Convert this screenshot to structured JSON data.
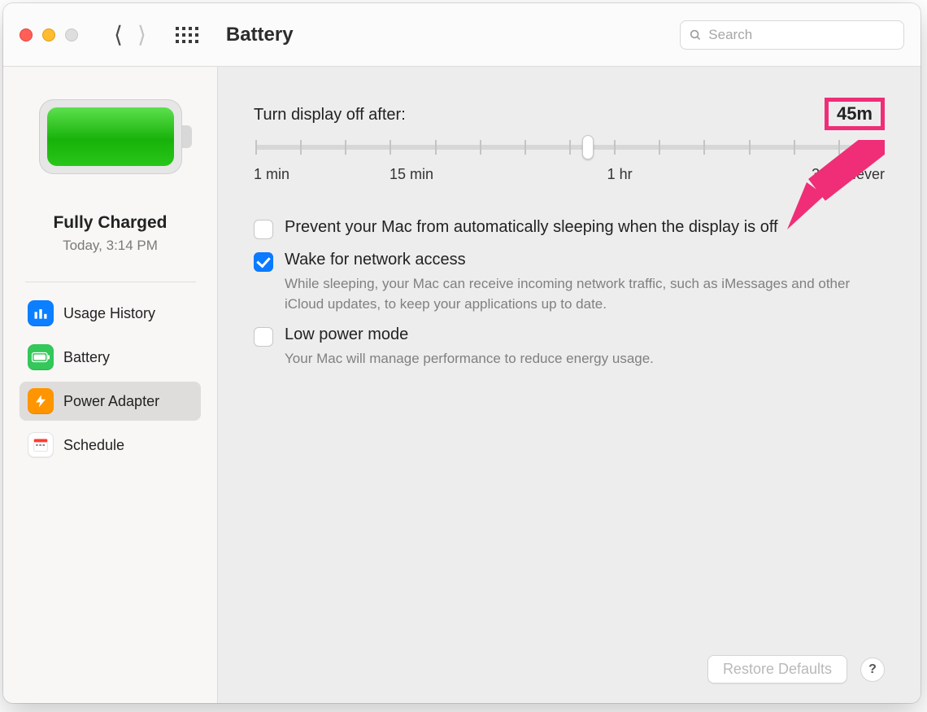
{
  "window": {
    "title": "Battery",
    "search_placeholder": "Search"
  },
  "sidebar": {
    "status_title": "Fully Charged",
    "status_subtitle": "Today, 3:14 PM",
    "items": [
      {
        "label": "Usage History",
        "icon": "chart-icon",
        "color": "blue",
        "selected": false
      },
      {
        "label": "Battery",
        "icon": "battery-icon",
        "color": "green",
        "selected": false
      },
      {
        "label": "Power Adapter",
        "icon": "bolt-icon",
        "color": "orange",
        "selected": true
      },
      {
        "label": "Schedule",
        "icon": "calendar-icon",
        "color": "white",
        "selected": false
      }
    ]
  },
  "main": {
    "slider": {
      "label": "Turn display off after:",
      "value_text": "45m",
      "value_percent": 53,
      "ticks_percent": [
        0,
        7.14,
        14.29,
        21.43,
        28.57,
        35.71,
        42.86,
        50,
        57.14,
        64.29,
        71.43,
        78.57,
        85.71,
        92.86,
        100
      ],
      "labels": [
        {
          "text": "1 min",
          "pos": 0
        },
        {
          "text": "15 min",
          "pos": 25
        },
        {
          "text": "1 hr",
          "pos": 58
        },
        {
          "text": "3 hrs",
          "pos": 91
        },
        {
          "text": "Never",
          "pos": 100
        }
      ]
    },
    "checks": [
      {
        "label": "Prevent your Mac from automatically sleeping when the display is off",
        "checked": false,
        "desc": ""
      },
      {
        "label": "Wake for network access",
        "checked": true,
        "desc": "While sleeping, your Mac can receive incoming network traffic, such as iMessages and other iCloud updates, to keep your applications up to date."
      },
      {
        "label": "Low power mode",
        "checked": false,
        "desc": "Your Mac will manage performance to reduce energy usage."
      }
    ],
    "restore_button": "Restore Defaults"
  },
  "annotation": {
    "arrow_color": "#ef2e77"
  }
}
